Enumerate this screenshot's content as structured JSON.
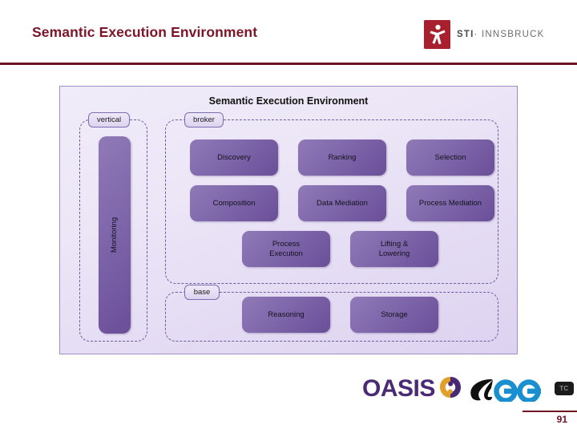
{
  "slide": {
    "title": "Semantic Execution Environment",
    "page_number": "91",
    "title_color": "#7E1428",
    "rule_color": "#6E1122"
  },
  "sti_logo": {
    "icon": "sti-person-icon",
    "wordmark_bold": "STI",
    "wordmark_separator": "·",
    "wordmark_rest": "INNSBRUCK",
    "mark_color": "#A81F2E"
  },
  "diagram": {
    "title": "Semantic Execution Environment",
    "accent_color": "#6a4f98",
    "border_color": "#9f8fc4",
    "regions": [
      {
        "id": "vertical",
        "label": "vertical"
      },
      {
        "id": "broker",
        "label": "broker"
      },
      {
        "id": "base",
        "label": "base"
      }
    ],
    "vertical_nodes": [
      {
        "id": "monitoring",
        "label": "Monitoring",
        "orientation": "vertical"
      }
    ],
    "broker_nodes": [
      {
        "id": "discovery",
        "label": "Discovery"
      },
      {
        "id": "ranking",
        "label": "Ranking"
      },
      {
        "id": "selection",
        "label": "Selection"
      },
      {
        "id": "composition",
        "label": "Composition"
      },
      {
        "id": "data-mediation",
        "label": "Data Mediation"
      },
      {
        "id": "process-mediation",
        "label": "Process Mediation"
      },
      {
        "id": "process-execution",
        "label": "Process\nExecution"
      },
      {
        "id": "lifting-lowering",
        "label": "Lifting &\nLowering"
      }
    ],
    "base_nodes": [
      {
        "id": "reasoning",
        "label": "Reasoning"
      },
      {
        "id": "storage",
        "label": "Storage"
      }
    ]
  },
  "bottom_logos": {
    "oasis_word": "OASIS",
    "oasis_mark_icon": "oasis-swirl-icon",
    "see_mark_icon": "see-wordmark-icon",
    "tc_badge": "TC",
    "oasis_color": "#4a2a74",
    "oasis_accent_color": "#e0a02a",
    "see_color": "#1a8fd0"
  }
}
